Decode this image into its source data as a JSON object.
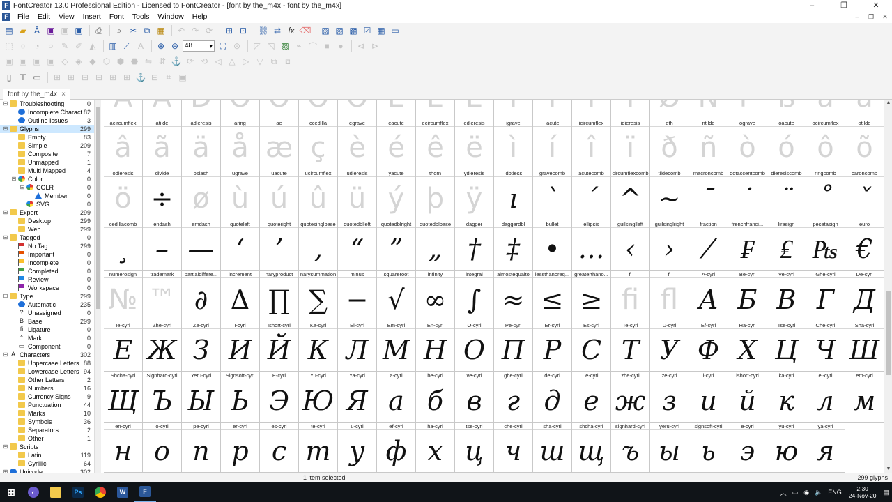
{
  "window": {
    "title": "FontCreator 13.0 Professional Edition - Licensed to FontCreator - [font by the_m4x - font by the_m4x]",
    "min": "–",
    "restore": "❐",
    "close": "✕"
  },
  "menu": [
    "File",
    "Edit",
    "View",
    "Insert",
    "Font",
    "Tools",
    "Window",
    "Help"
  ],
  "zoom": "48",
  "tab": {
    "label": "font by the_m4x",
    "close": "×"
  },
  "tree": [
    {
      "label": "Troubleshooting",
      "count": "0",
      "lvl": 0,
      "exp": "⊟",
      "icon": "folder"
    },
    {
      "label": "Incomplete Charact...",
      "count": "82",
      "lvl": 1,
      "icon": "info"
    },
    {
      "label": "Outline Issues",
      "count": "3",
      "lvl": 1,
      "icon": "info"
    },
    {
      "label": "Glyphs",
      "count": "299",
      "lvl": 0,
      "exp": "⊟",
      "icon": "folder",
      "sel": true
    },
    {
      "label": "Empty",
      "count": "83",
      "lvl": 1,
      "icon": "folder"
    },
    {
      "label": "Simple",
      "count": "209",
      "lvl": 1,
      "icon": "folder"
    },
    {
      "label": "Composite",
      "count": "7",
      "lvl": 1,
      "icon": "folder"
    },
    {
      "label": "Unmapped",
      "count": "1",
      "lvl": 1,
      "icon": "folder"
    },
    {
      "label": "Multi Mapped",
      "count": "4",
      "lvl": 1,
      "icon": "folder"
    },
    {
      "label": "Color",
      "count": "0",
      "lvl": 1,
      "exp": "⊟",
      "icon": "color"
    },
    {
      "label": "COLR",
      "count": "0",
      "lvl": 2,
      "exp": "⊟",
      "icon": "color"
    },
    {
      "label": "Member",
      "count": "0",
      "lvl": 3,
      "icon": "tri"
    },
    {
      "label": "SVG",
      "count": "0",
      "lvl": 2,
      "icon": "color"
    },
    {
      "label": "Export",
      "count": "299",
      "lvl": 0,
      "exp": "⊟",
      "icon": "folder"
    },
    {
      "label": "Desktop",
      "count": "299",
      "lvl": 1,
      "icon": "folder"
    },
    {
      "label": "Web",
      "count": "299",
      "lvl": 1,
      "icon": "folder"
    },
    {
      "label": "Tagged",
      "count": "0",
      "lvl": 0,
      "exp": "⊟",
      "icon": "folder"
    },
    {
      "label": "No Tag",
      "count": "299",
      "lvl": 1,
      "icon": "flag",
      "fc": "#d32f2f"
    },
    {
      "label": "Important",
      "count": "0",
      "lvl": 1,
      "icon": "flag",
      "fc": "#e65100"
    },
    {
      "label": "Incomplete",
      "count": "0",
      "lvl": 1,
      "icon": "flag",
      "fc": "#fbc02d"
    },
    {
      "label": "Completed",
      "count": "0",
      "lvl": 1,
      "icon": "flag",
      "fc": "#43a047"
    },
    {
      "label": "Review",
      "count": "0",
      "lvl": 1,
      "icon": "flag",
      "fc": "#1e88e5"
    },
    {
      "label": "Workspace",
      "count": "0",
      "lvl": 1,
      "icon": "flag",
      "fc": "#8e24aa"
    },
    {
      "label": "Type",
      "count": "299",
      "lvl": 0,
      "exp": "⊟",
      "icon": "folder"
    },
    {
      "label": "Automatic",
      "count": "235",
      "lvl": 1,
      "icon": "info"
    },
    {
      "label": "Unassigned",
      "count": "0",
      "lvl": 1,
      "icon": "glyph",
      "g": "?"
    },
    {
      "label": "Base",
      "count": "299",
      "lvl": 1,
      "icon": "glyph",
      "g": "B"
    },
    {
      "label": "Ligature",
      "count": "0",
      "lvl": 1,
      "icon": "glyph",
      "g": "fi"
    },
    {
      "label": "Mark",
      "count": "0",
      "lvl": 1,
      "icon": "glyph",
      "g": "^"
    },
    {
      "label": "Component",
      "count": "0",
      "lvl": 1,
      "icon": "glyph",
      "g": "▭"
    },
    {
      "label": "Characters",
      "count": "302",
      "lvl": 0,
      "exp": "⊟",
      "icon": "glyph",
      "g": "A"
    },
    {
      "label": "Uppercase Letters",
      "count": "88",
      "lvl": 1,
      "icon": "folder"
    },
    {
      "label": "Lowercase Letters",
      "count": "94",
      "lvl": 1,
      "icon": "folder"
    },
    {
      "label": "Other Letters",
      "count": "2",
      "lvl": 1,
      "icon": "folder"
    },
    {
      "label": "Numbers",
      "count": "16",
      "lvl": 1,
      "icon": "folder"
    },
    {
      "label": "Currency Signs",
      "count": "9",
      "lvl": 1,
      "icon": "folder"
    },
    {
      "label": "Punctuation",
      "count": "44",
      "lvl": 1,
      "icon": "folder"
    },
    {
      "label": "Marks",
      "count": "10",
      "lvl": 1,
      "icon": "folder"
    },
    {
      "label": "Symbols",
      "count": "36",
      "lvl": 1,
      "icon": "folder"
    },
    {
      "label": "Separators",
      "count": "2",
      "lvl": 1,
      "icon": "folder"
    },
    {
      "label": "Other",
      "count": "1",
      "lvl": 1,
      "icon": "folder"
    },
    {
      "label": "Scripts",
      "count": "",
      "lvl": 0,
      "exp": "⊟",
      "icon": "folder"
    },
    {
      "label": "Latin",
      "count": "119",
      "lvl": 1,
      "icon": "folder"
    },
    {
      "label": "Cyrillic",
      "count": "64",
      "lvl": 1,
      "icon": "folder"
    },
    {
      "label": "Unicode",
      "count": "302",
      "lvl": 0,
      "exp": "⊞",
      "icon": "info"
    }
  ],
  "glyphs": [
    {
      "n": "",
      "c": "Á",
      "e": 1
    },
    {
      "n": "",
      "c": "Â",
      "e": 1
    },
    {
      "n": "",
      "c": "D",
      "e": 1
    },
    {
      "n": "",
      "c": "O",
      "e": 1
    },
    {
      "n": "",
      "c": "O",
      "e": 1
    },
    {
      "n": "",
      "c": "O",
      "e": 1
    },
    {
      "n": "",
      "c": "O",
      "e": 1
    },
    {
      "n": "",
      "c": "E",
      "e": 1
    },
    {
      "n": "",
      "c": "E",
      "e": 1
    },
    {
      "n": "",
      "c": "E",
      "e": 1
    },
    {
      "n": "",
      "c": "I",
      "e": 1
    },
    {
      "n": "",
      "c": "I",
      "e": 1
    },
    {
      "n": "",
      "c": "I",
      "e": 1
    },
    {
      "n": "",
      "c": "I",
      "e": 1
    },
    {
      "n": "",
      "c": "Ø",
      "e": 1
    },
    {
      "n": "",
      "c": "Ñ",
      "e": 1
    },
    {
      "n": "",
      "c": "P",
      "e": 1
    },
    {
      "n": "",
      "c": "ß",
      "e": 1
    },
    {
      "n": "",
      "c": "a",
      "e": 1
    },
    {
      "n": "",
      "c": "a",
      "e": 1
    },
    {
      "n": "acircumflex",
      "c": "â",
      "e": 1
    },
    {
      "n": "atilde",
      "c": "ã",
      "e": 1
    },
    {
      "n": "adieresis",
      "c": "ä",
      "e": 1
    },
    {
      "n": "aring",
      "c": "å",
      "e": 1
    },
    {
      "n": "ae",
      "c": "æ",
      "e": 1
    },
    {
      "n": "ccedilla",
      "c": "ç",
      "e": 1
    },
    {
      "n": "egrave",
      "c": "è",
      "e": 1
    },
    {
      "n": "eacute",
      "c": "é",
      "e": 1
    },
    {
      "n": "ecircumflex",
      "c": "ê",
      "e": 1
    },
    {
      "n": "edieresis",
      "c": "ë",
      "e": 1
    },
    {
      "n": "igrave",
      "c": "ì",
      "e": 1
    },
    {
      "n": "iacute",
      "c": "í",
      "e": 1
    },
    {
      "n": "icircumflex",
      "c": "î",
      "e": 1
    },
    {
      "n": "idieresis",
      "c": "ï",
      "e": 1
    },
    {
      "n": "eth",
      "c": "ð",
      "e": 1
    },
    {
      "n": "ntilde",
      "c": "ñ",
      "e": 1
    },
    {
      "n": "ograve",
      "c": "ò",
      "e": 1
    },
    {
      "n": "oacute",
      "c": "ó",
      "e": 1
    },
    {
      "n": "ocircumflex",
      "c": "ô",
      "e": 1
    },
    {
      "n": "otilde",
      "c": "õ",
      "e": 1
    },
    {
      "n": "odieresis",
      "c": "ö",
      "e": 1
    },
    {
      "n": "divide",
      "c": "÷"
    },
    {
      "n": "oslash",
      "c": "ø",
      "e": 1
    },
    {
      "n": "ugrave",
      "c": "ù",
      "e": 1
    },
    {
      "n": "uacute",
      "c": "ú",
      "e": 1
    },
    {
      "n": "ucircumflex",
      "c": "û",
      "e": 1
    },
    {
      "n": "udieresis",
      "c": "ü",
      "e": 1
    },
    {
      "n": "yacute",
      "c": "ý",
      "e": 1
    },
    {
      "n": "thorn",
      "c": "þ",
      "e": 1
    },
    {
      "n": "ydieresis",
      "c": "ÿ",
      "e": 1
    },
    {
      "n": "idotless",
      "c": "ı"
    },
    {
      "n": "gravecomb",
      "c": "`"
    },
    {
      "n": "acutecomb",
      "c": "´"
    },
    {
      "n": "circumflexcomb",
      "c": "^"
    },
    {
      "n": "tildecomb",
      "c": "~"
    },
    {
      "n": "macroncomb",
      "c": "¯"
    },
    {
      "n": "dotaccentcomb",
      "c": "˙"
    },
    {
      "n": "dieresiscomb",
      "c": "¨"
    },
    {
      "n": "ringcomb",
      "c": "˚"
    },
    {
      "n": "caroncomb",
      "c": "ˇ"
    },
    {
      "n": "cedillacomb",
      "c": "¸"
    },
    {
      "n": "endash",
      "c": "–"
    },
    {
      "n": "emdash",
      "c": "—"
    },
    {
      "n": "quoteleft",
      "c": "‘"
    },
    {
      "n": "quoteright",
      "c": "’"
    },
    {
      "n": "quotesinglbase",
      "c": "‚"
    },
    {
      "n": "quotedblleft",
      "c": "“"
    },
    {
      "n": "quotedblright",
      "c": "”"
    },
    {
      "n": "quotedblbase",
      "c": "„"
    },
    {
      "n": "dagger",
      "c": "†"
    },
    {
      "n": "daggerdbl",
      "c": "‡"
    },
    {
      "n": "bullet",
      "c": "•"
    },
    {
      "n": "ellipsis",
      "c": "…"
    },
    {
      "n": "guilsinglleft",
      "c": "‹"
    },
    {
      "n": "guilsinglright",
      "c": "›"
    },
    {
      "n": "fraction",
      "c": "⁄"
    },
    {
      "n": "frenchfranci...",
      "c": "₣"
    },
    {
      "n": "lirasign",
      "c": "₤"
    },
    {
      "n": "pesetasign",
      "c": "₧"
    },
    {
      "n": "euro",
      "c": "€"
    },
    {
      "n": "numerosign",
      "c": "№",
      "e": 1
    },
    {
      "n": "trademark",
      "c": "™",
      "e": 1
    },
    {
      "n": "partialdiffere...",
      "c": "∂"
    },
    {
      "n": "increment",
      "c": "∆"
    },
    {
      "n": "naryproduct",
      "c": "∏"
    },
    {
      "n": "narysummation",
      "c": "∑"
    },
    {
      "n": "minus",
      "c": "−"
    },
    {
      "n": "squareroot",
      "c": "√"
    },
    {
      "n": "infinity",
      "c": "∞"
    },
    {
      "n": "integral",
      "c": "∫"
    },
    {
      "n": "almostequalto",
      "c": "≈"
    },
    {
      "n": "lessthanoreq...",
      "c": "≤"
    },
    {
      "n": "greaterthano...",
      "c": "≥"
    },
    {
      "n": "fi",
      "c": "fi",
      "e": 1
    },
    {
      "n": "fl",
      "c": "fl",
      "e": 1
    },
    {
      "n": "A-cyrl",
      "c": "А"
    },
    {
      "n": "Be-cyrl",
      "c": "Б"
    },
    {
      "n": "Ve-cyrl",
      "c": "В"
    },
    {
      "n": "Ghe-cyrl",
      "c": "Г"
    },
    {
      "n": "De-cyrl",
      "c": "Д"
    },
    {
      "n": "Ie-cyrl",
      "c": "Е"
    },
    {
      "n": "Zhe-cyrl",
      "c": "Ж"
    },
    {
      "n": "Ze-cyrl",
      "c": "З"
    },
    {
      "n": "I-cyrl",
      "c": "И"
    },
    {
      "n": "Ishort-cyrl",
      "c": "Й"
    },
    {
      "n": "Ka-cyrl",
      "c": "К"
    },
    {
      "n": "El-cyrl",
      "c": "Л"
    },
    {
      "n": "Em-cyrl",
      "c": "М"
    },
    {
      "n": "En-cyrl",
      "c": "Н"
    },
    {
      "n": "O-cyrl",
      "c": "О"
    },
    {
      "n": "Pe-cyrl",
      "c": "П"
    },
    {
      "n": "Er-cyrl",
      "c": "Р"
    },
    {
      "n": "Es-cyrl",
      "c": "С"
    },
    {
      "n": "Te-cyrl",
      "c": "Т"
    },
    {
      "n": "U-cyrl",
      "c": "У"
    },
    {
      "n": "Ef-cyrl",
      "c": "Ф"
    },
    {
      "n": "Ha-cyrl",
      "c": "Х"
    },
    {
      "n": "Tse-cyrl",
      "c": "Ц"
    },
    {
      "n": "Che-cyrl",
      "c": "Ч"
    },
    {
      "n": "Sha-cyrl",
      "c": "Ш"
    },
    {
      "n": "Shcha-cyrl",
      "c": "Щ"
    },
    {
      "n": "Signhard-cyrl",
      "c": "Ъ"
    },
    {
      "n": "Yeru-cyrl",
      "c": "Ы"
    },
    {
      "n": "Signsoft-cyrl",
      "c": "Ь"
    },
    {
      "n": "E-cyrl",
      "c": "Э"
    },
    {
      "n": "Yu-cyrl",
      "c": "Ю"
    },
    {
      "n": "Ya-cyrl",
      "c": "Я"
    },
    {
      "n": "a-cyrl",
      "c": "а"
    },
    {
      "n": "be-cyrl",
      "c": "б"
    },
    {
      "n": "ve-cyrl",
      "c": "в"
    },
    {
      "n": "ghe-cyrl",
      "c": "г"
    },
    {
      "n": "de-cyrl",
      "c": "д"
    },
    {
      "n": "ie-cyrl",
      "c": "е"
    },
    {
      "n": "zhe-cyrl",
      "c": "ж"
    },
    {
      "n": "ze-cyrl",
      "c": "з"
    },
    {
      "n": "i-cyrl",
      "c": "и"
    },
    {
      "n": "ishort-cyrl",
      "c": "й"
    },
    {
      "n": "ka-cyrl",
      "c": "к"
    },
    {
      "n": "el-cyrl",
      "c": "л"
    },
    {
      "n": "em-cyrl",
      "c": "м"
    },
    {
      "n": "en-cyrl",
      "c": "н"
    },
    {
      "n": "o-cyrl",
      "c": "о"
    },
    {
      "n": "pe-cyrl",
      "c": "п"
    },
    {
      "n": "er-cyrl",
      "c": "р"
    },
    {
      "n": "es-cyrl",
      "c": "с"
    },
    {
      "n": "te-cyrl",
      "c": "т"
    },
    {
      "n": "u-cyrl",
      "c": "у"
    },
    {
      "n": "ef-cyrl",
      "c": "ф"
    },
    {
      "n": "ha-cyrl",
      "c": "х"
    },
    {
      "n": "tse-cyrl",
      "c": "ц"
    },
    {
      "n": "che-cyrl",
      "c": "ч"
    },
    {
      "n": "sha-cyrl",
      "c": "ш"
    },
    {
      "n": "shcha-cyrl",
      "c": "щ"
    },
    {
      "n": "signhard-cyrl",
      "c": "ъ"
    },
    {
      "n": "yeru-cyrl",
      "c": "ы"
    },
    {
      "n": "signsoft-cyrl",
      "c": "ь"
    },
    {
      "n": "e-cyrl",
      "c": "э"
    },
    {
      "n": "yu-cyrl",
      "c": "ю"
    },
    {
      "n": "ya-cyrl",
      "c": "я"
    }
  ],
  "status": {
    "selection": "1 item selected",
    "count": "299 glyphs"
  },
  "taskbar": {
    "lang": "ENG",
    "time": "2:30",
    "date": "24-Nov-20"
  }
}
